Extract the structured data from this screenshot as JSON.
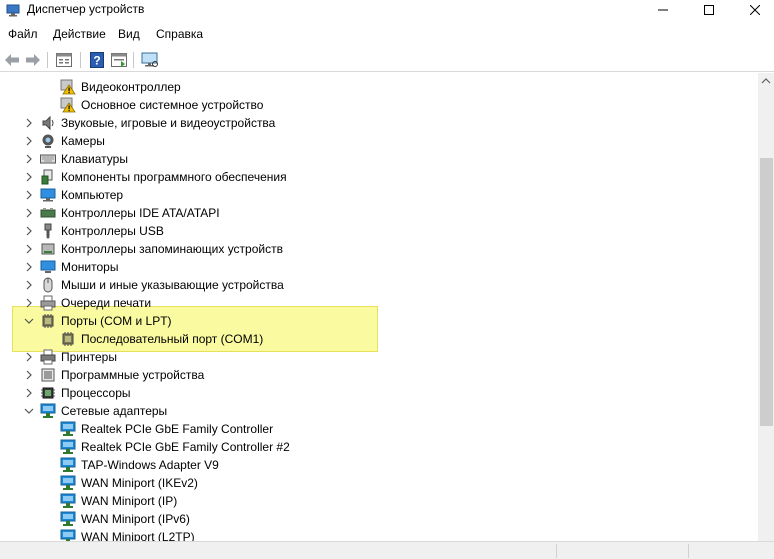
{
  "window": {
    "title": "Диспетчер устройств",
    "minimize_glyph": "—",
    "maximize_glyph": "☐",
    "close_glyph": "✕"
  },
  "menu": [
    "Файл",
    "Действие",
    "Вид",
    "Справка"
  ],
  "toolbar": {
    "buttons": [
      "back-icon",
      "forward-icon",
      "properties-icon",
      "help-icon",
      "show-hidden-icon",
      "scan-hardware-icon"
    ]
  },
  "tree": {
    "rows": [
      {
        "label": "Видеоконтроллер",
        "icon": "warning-device-icon",
        "level": 2,
        "expander": "none"
      },
      {
        "label": "Основное системное устройство",
        "icon": "warning-device-icon",
        "level": 2,
        "expander": "none"
      },
      {
        "label": "Звуковые, игровые и видеоустройства",
        "icon": "speaker-icon",
        "level": 1,
        "expander": "collapsed"
      },
      {
        "label": "Камеры",
        "icon": "camera-icon",
        "level": 1,
        "expander": "collapsed"
      },
      {
        "label": "Клавиатуры",
        "icon": "keyboard-icon",
        "level": 1,
        "expander": "collapsed"
      },
      {
        "label": "Компоненты программного обеспечения",
        "icon": "software-component-icon",
        "level": 1,
        "expander": "collapsed"
      },
      {
        "label": "Компьютер",
        "icon": "computer-icon",
        "level": 1,
        "expander": "collapsed"
      },
      {
        "label": "Контроллеры IDE ATA/ATAPI",
        "icon": "ide-controller-icon",
        "level": 1,
        "expander": "collapsed"
      },
      {
        "label": "Контроллеры USB",
        "icon": "usb-icon",
        "level": 1,
        "expander": "collapsed"
      },
      {
        "label": "Контроллеры запоминающих устройств",
        "icon": "storage-controller-icon",
        "level": 1,
        "expander": "collapsed"
      },
      {
        "label": "Мониторы",
        "icon": "monitor-icon",
        "level": 1,
        "expander": "collapsed"
      },
      {
        "label": "Мыши и иные указывающие устройства",
        "icon": "mouse-icon",
        "level": 1,
        "expander": "collapsed"
      },
      {
        "label": "Очереди печати",
        "icon": "printer-queue-icon",
        "level": 1,
        "expander": "collapsed"
      },
      {
        "label": "Порты (COM и LPT)",
        "icon": "port-icon",
        "level": 1,
        "expander": "expanded"
      },
      {
        "label": "Последовательный порт (COM1)",
        "icon": "port-icon",
        "level": 2,
        "expander": "none"
      },
      {
        "label": "Принтеры",
        "icon": "printer-icon",
        "level": 1,
        "expander": "collapsed"
      },
      {
        "label": "Программные устройства",
        "icon": "software-device-icon",
        "level": 1,
        "expander": "collapsed"
      },
      {
        "label": "Процессоры",
        "icon": "processor-icon",
        "level": 1,
        "expander": "collapsed"
      },
      {
        "label": "Сетевые адаптеры",
        "icon": "network-adapter-icon",
        "level": 1,
        "expander": "expanded"
      },
      {
        "label": "Realtek PCIe GbE Family Controller",
        "icon": "network-adapter-icon",
        "level": 2,
        "expander": "none"
      },
      {
        "label": "Realtek PCIe GbE Family Controller #2",
        "icon": "network-adapter-icon",
        "level": 2,
        "expander": "none"
      },
      {
        "label": "TAP-Windows Adapter V9",
        "icon": "network-adapter-icon",
        "level": 2,
        "expander": "none"
      },
      {
        "label": "WAN Miniport (IKEv2)",
        "icon": "network-adapter-icon",
        "level": 2,
        "expander": "none"
      },
      {
        "label": "WAN Miniport (IP)",
        "icon": "network-adapter-icon",
        "level": 2,
        "expander": "none"
      },
      {
        "label": "WAN Miniport (IPv6)",
        "icon": "network-adapter-icon",
        "level": 2,
        "expander": "none"
      },
      {
        "label": "WAN Miniport (L2TP)",
        "icon": "network-adapter-icon",
        "level": 2,
        "expander": "none"
      }
    ],
    "highlighted_rows": [
      "Порты (COM и LPT)",
      "Последовательный порт (COM1)"
    ]
  },
  "colors": {
    "highlight_fill": "#fafaa0",
    "highlight_border": "#e6e05a",
    "network_blue": "#1c8ad6",
    "warning_yellow": "#f2c200"
  }
}
